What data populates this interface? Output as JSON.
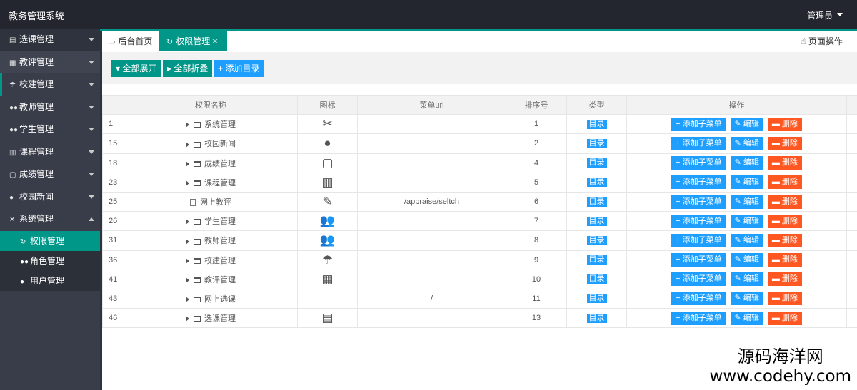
{
  "header": {
    "title": "教务管理系统",
    "user": "管理员"
  },
  "sidebar": {
    "items": [
      {
        "label": "选课管理",
        "icon": "document-icon"
      },
      {
        "label": "教评管理",
        "icon": "grid-icon"
      },
      {
        "label": "校建管理",
        "icon": "palm-tree-icon"
      },
      {
        "label": "教师管理",
        "icon": "users-icon"
      },
      {
        "label": "学生管理",
        "icon": "users-icon"
      },
      {
        "label": "课程管理",
        "icon": "book-icon"
      },
      {
        "label": "成绩管理",
        "icon": "clipboard-icon"
      },
      {
        "label": "校园新闻",
        "icon": "chat-icon"
      },
      {
        "label": "系统管理",
        "icon": "tools-icon"
      }
    ],
    "subitems": [
      {
        "label": "权限管理",
        "icon": "refresh-icon"
      },
      {
        "label": "角色管理",
        "icon": "users-icon"
      },
      {
        "label": "用户管理",
        "icon": "user-icon"
      }
    ]
  },
  "tabs": {
    "home": "后台首页",
    "current": "权限管理",
    "page_op": "页面操作"
  },
  "toolbar": {
    "expand_all": "全部展开",
    "collapse_all": "全部折叠",
    "add_dir": "添加目录"
  },
  "table": {
    "columns": [
      "权限名称",
      "图标",
      "菜单url",
      "排序号",
      "类型",
      "操作"
    ],
    "rows": [
      {
        "id": "1",
        "name": "系统管理",
        "icon": "tools-icon",
        "url": "",
        "sort": "1",
        "type": "目录",
        "folder": true
      },
      {
        "id": "15",
        "name": "校园新闻",
        "icon": "chat-icon",
        "url": "",
        "sort": "2",
        "type": "目录",
        "folder": true
      },
      {
        "id": "18",
        "name": "成绩管理",
        "icon": "clipboard-icon",
        "url": "",
        "sort": "4",
        "type": "目录",
        "folder": true
      },
      {
        "id": "23",
        "name": "课程管理",
        "icon": "book-icon",
        "url": "",
        "sort": "5",
        "type": "目录",
        "folder": true
      },
      {
        "id": "25",
        "name": "网上教评",
        "icon": "survey-icon",
        "url": "/appraise/seltch",
        "sort": "6",
        "type": "目录",
        "folder": false
      },
      {
        "id": "26",
        "name": "学生管理",
        "icon": "users-icon",
        "url": "",
        "sort": "7",
        "type": "目录",
        "folder": true
      },
      {
        "id": "31",
        "name": "教师管理",
        "icon": "users-icon",
        "url": "",
        "sort": "8",
        "type": "目录",
        "folder": true
      },
      {
        "id": "36",
        "name": "校建管理",
        "icon": "palm-tree-icon",
        "url": "",
        "sort": "9",
        "type": "目录",
        "folder": true
      },
      {
        "id": "41",
        "name": "教评管理",
        "icon": "grid-icon",
        "url": "",
        "sort": "10",
        "type": "目录",
        "folder": true
      },
      {
        "id": "43",
        "name": "网上选课",
        "icon": "",
        "url": "/",
        "sort": "11",
        "type": "目录",
        "folder": true
      },
      {
        "id": "46",
        "name": "选课管理",
        "icon": "document-icon",
        "url": "",
        "sort": "13",
        "type": "目录",
        "folder": true
      }
    ],
    "actions": {
      "add_sub": "添加子菜单",
      "edit": "编辑",
      "delete": "删除"
    }
  },
  "watermark": {
    "line1": "源码海洋网",
    "line2": "www.codehy.com"
  },
  "colors": {
    "accent": "#009688",
    "blue": "#1e9fff",
    "red": "#ff5722",
    "header": "#23262e",
    "sidebar": "#393d49"
  }
}
